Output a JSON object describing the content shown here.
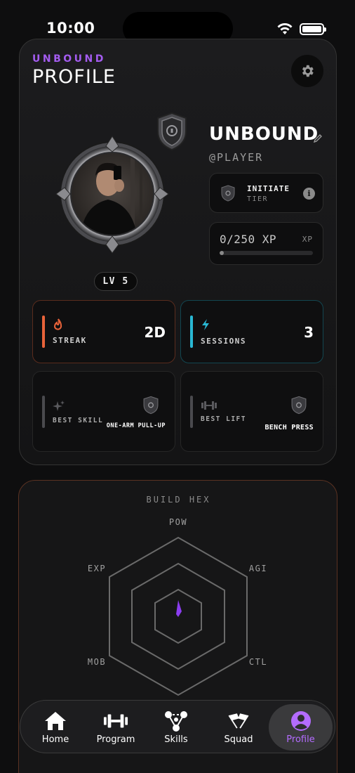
{
  "status_bar": {
    "time": "10:00"
  },
  "header": {
    "eyebrow": "UNBOUND",
    "title": "PROFILE"
  },
  "profile": {
    "username": "UNBOUND",
    "handle": "@PLAYER",
    "level": "LV 5",
    "tier_name": "INITIATE",
    "tier_sub": "TIER",
    "xp_text": "0/250 XP",
    "xp_tag": "XP",
    "xp_progress": 0.0
  },
  "stats": {
    "streak": {
      "label": "STREAK",
      "value": "2D",
      "color": "#e8633a"
    },
    "sessions": {
      "label": "SESSIONS",
      "value": "3",
      "color": "#29b8d4"
    },
    "best_skill": {
      "label": "BEST SKILL",
      "value": "ONE-ARM PULL-UP"
    },
    "best_lift": {
      "label": "BEST LIFT",
      "value": "BENCH PRESS"
    }
  },
  "build_hex": {
    "title": "BUILD HEX",
    "axes": [
      "POW",
      "AGI",
      "CTL",
      "MOB",
      "EXP"
    ],
    "accent": "#8b3df0"
  },
  "tabs": [
    {
      "label": "Home",
      "icon": "home-icon"
    },
    {
      "label": "Program",
      "icon": "dumbbell-icon"
    },
    {
      "label": "Skills",
      "icon": "skill-tree-icon"
    },
    {
      "label": "Squad",
      "icon": "flags-icon"
    },
    {
      "label": "Profile",
      "icon": "person-icon",
      "active": true
    }
  ],
  "colors": {
    "accent": "#a45cf0",
    "active_tab": "#b46cff"
  }
}
